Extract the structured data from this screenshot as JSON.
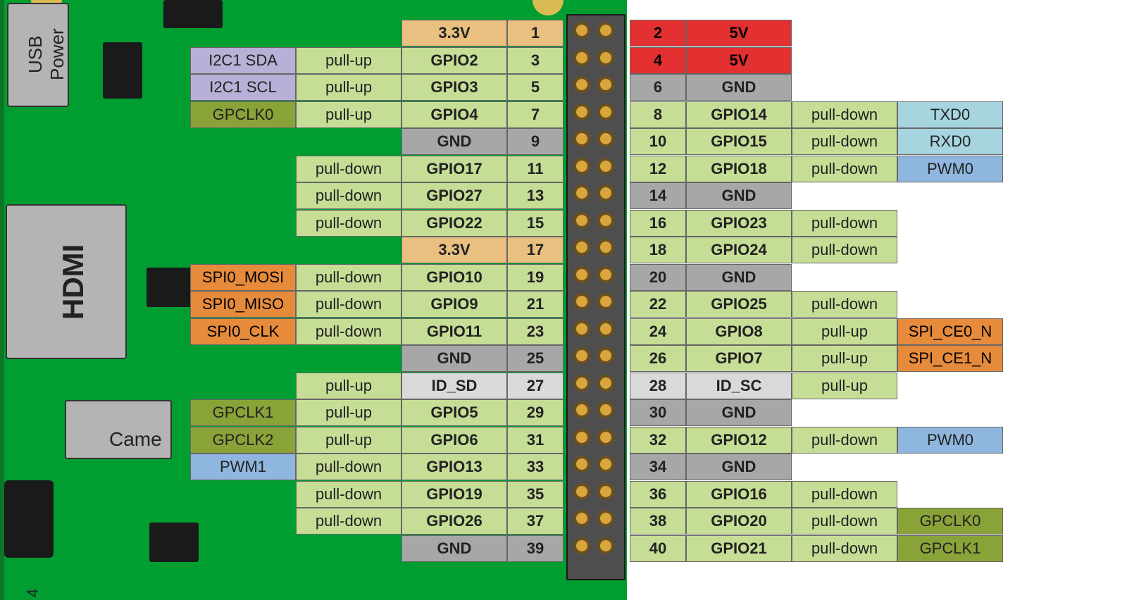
{
  "labels": {
    "usb_power": "USB Power",
    "hdmi": "HDMI",
    "camera": "Came",
    "page_number": "4"
  },
  "colors": {
    "board": "#009e30",
    "v33": "#e9c080",
    "v5": "#e33030",
    "gnd": "#a7a7a7",
    "gpio": "#c6dd96",
    "id": "#d9d9d9",
    "i2c": "#b8b0d6",
    "spi": "#e68a3c",
    "uart": "#a6d5e0",
    "pwm": "#8fb6de",
    "clk": "#8aa338"
  },
  "pins": {
    "left": [
      {
        "num": "1",
        "name": "3.3V",
        "nameClass": "c-v33"
      },
      {
        "num": "3",
        "name": "GPIO2",
        "nameClass": "c-gpio",
        "pull": "pull-up",
        "alt": "I2C1 SDA",
        "altClass": "c-i2c"
      },
      {
        "num": "5",
        "name": "GPIO3",
        "nameClass": "c-gpio",
        "pull": "pull-up",
        "alt": "I2C1 SCL",
        "altClass": "c-i2c"
      },
      {
        "num": "7",
        "name": "GPIO4",
        "nameClass": "c-gpio",
        "pull": "pull-up",
        "alt": "GPCLK0",
        "altClass": "c-clk"
      },
      {
        "num": "9",
        "name": "GND",
        "nameClass": "c-gnd"
      },
      {
        "num": "11",
        "name": "GPIO17",
        "nameClass": "c-gpio",
        "pull": "pull-down"
      },
      {
        "num": "13",
        "name": "GPIO27",
        "nameClass": "c-gpio",
        "pull": "pull-down"
      },
      {
        "num": "15",
        "name": "GPIO22",
        "nameClass": "c-gpio",
        "pull": "pull-down"
      },
      {
        "num": "17",
        "name": "3.3V",
        "nameClass": "c-v33"
      },
      {
        "num": "19",
        "name": "GPIO10",
        "nameClass": "c-gpio",
        "pull": "pull-down",
        "alt": "SPI0_MOSI",
        "altClass": "c-spi"
      },
      {
        "num": "21",
        "name": "GPIO9",
        "nameClass": "c-gpio",
        "pull": "pull-down",
        "alt": "SPI0_MISO",
        "altClass": "c-spi"
      },
      {
        "num": "23",
        "name": "GPIO11",
        "nameClass": "c-gpio",
        "pull": "pull-down",
        "alt": "SPI0_CLK",
        "altClass": "c-spi"
      },
      {
        "num": "25",
        "name": "GND",
        "nameClass": "c-gnd"
      },
      {
        "num": "27",
        "name": "ID_SD",
        "nameClass": "c-id",
        "pull": "pull-up"
      },
      {
        "num": "29",
        "name": "GPIO5",
        "nameClass": "c-gpio",
        "pull": "pull-up",
        "alt": "GPCLK1",
        "altClass": "c-clk"
      },
      {
        "num": "31",
        "name": "GPIO6",
        "nameClass": "c-gpio",
        "pull": "pull-up",
        "alt": "GPCLK2",
        "altClass": "c-clk"
      },
      {
        "num": "33",
        "name": "GPIO13",
        "nameClass": "c-gpio",
        "pull": "pull-down",
        "alt": "PWM1",
        "altClass": "c-pwm"
      },
      {
        "num": "35",
        "name": "GPIO19",
        "nameClass": "c-gpio",
        "pull": "pull-down"
      },
      {
        "num": "37",
        "name": "GPIO26",
        "nameClass": "c-gpio",
        "pull": "pull-down"
      },
      {
        "num": "39",
        "name": "GND",
        "nameClass": "c-gnd"
      }
    ],
    "right": [
      {
        "num": "2",
        "name": "5V",
        "nameClass": "c-v5",
        "numClass": "c-v5"
      },
      {
        "num": "4",
        "name": "5V",
        "nameClass": "c-v5",
        "numClass": "c-v5"
      },
      {
        "num": "6",
        "name": "GND",
        "nameClass": "c-gnd"
      },
      {
        "num": "8",
        "name": "GPIO14",
        "nameClass": "c-gpio",
        "pull": "pull-down",
        "alt": "TXD0",
        "altClass": "c-uart"
      },
      {
        "num": "10",
        "name": "GPIO15",
        "nameClass": "c-gpio",
        "pull": "pull-down",
        "alt": "RXD0",
        "altClass": "c-uart"
      },
      {
        "num": "12",
        "name": "GPIO18",
        "nameClass": "c-gpio",
        "pull": "pull-down",
        "alt": "PWM0",
        "altClass": "c-pwm"
      },
      {
        "num": "14",
        "name": "GND",
        "nameClass": "c-gnd"
      },
      {
        "num": "16",
        "name": "GPIO23",
        "nameClass": "c-gpio",
        "pull": "pull-down"
      },
      {
        "num": "18",
        "name": "GPIO24",
        "nameClass": "c-gpio",
        "pull": "pull-down"
      },
      {
        "num": "20",
        "name": "GND",
        "nameClass": "c-gnd"
      },
      {
        "num": "22",
        "name": "GPIO25",
        "nameClass": "c-gpio",
        "pull": "pull-down"
      },
      {
        "num": "24",
        "name": "GPIO8",
        "nameClass": "c-gpio",
        "pull": "pull-up",
        "alt": "SPI_CE0_N",
        "altClass": "c-spi"
      },
      {
        "num": "26",
        "name": "GPIO7",
        "nameClass": "c-gpio",
        "pull": "pull-up",
        "alt": "SPI_CE1_N",
        "altClass": "c-spi"
      },
      {
        "num": "28",
        "name": "ID_SC",
        "nameClass": "c-id",
        "pull": "pull-up"
      },
      {
        "num": "30",
        "name": "GND",
        "nameClass": "c-gnd"
      },
      {
        "num": "32",
        "name": "GPIO12",
        "nameClass": "c-gpio",
        "pull": "pull-down",
        "alt": "PWM0",
        "altClass": "c-pwm"
      },
      {
        "num": "34",
        "name": "GND",
        "nameClass": "c-gnd"
      },
      {
        "num": "36",
        "name": "GPIO16",
        "nameClass": "c-gpio",
        "pull": "pull-down"
      },
      {
        "num": "38",
        "name": "GPIO20",
        "nameClass": "c-gpio",
        "pull": "pull-down",
        "alt": "GPCLK0",
        "altClass": "c-clk"
      },
      {
        "num": "40",
        "name": "GPIO21",
        "nameClass": "c-gpio",
        "pull": "pull-down",
        "alt": "GPCLK1",
        "altClass": "c-clk"
      }
    ]
  }
}
